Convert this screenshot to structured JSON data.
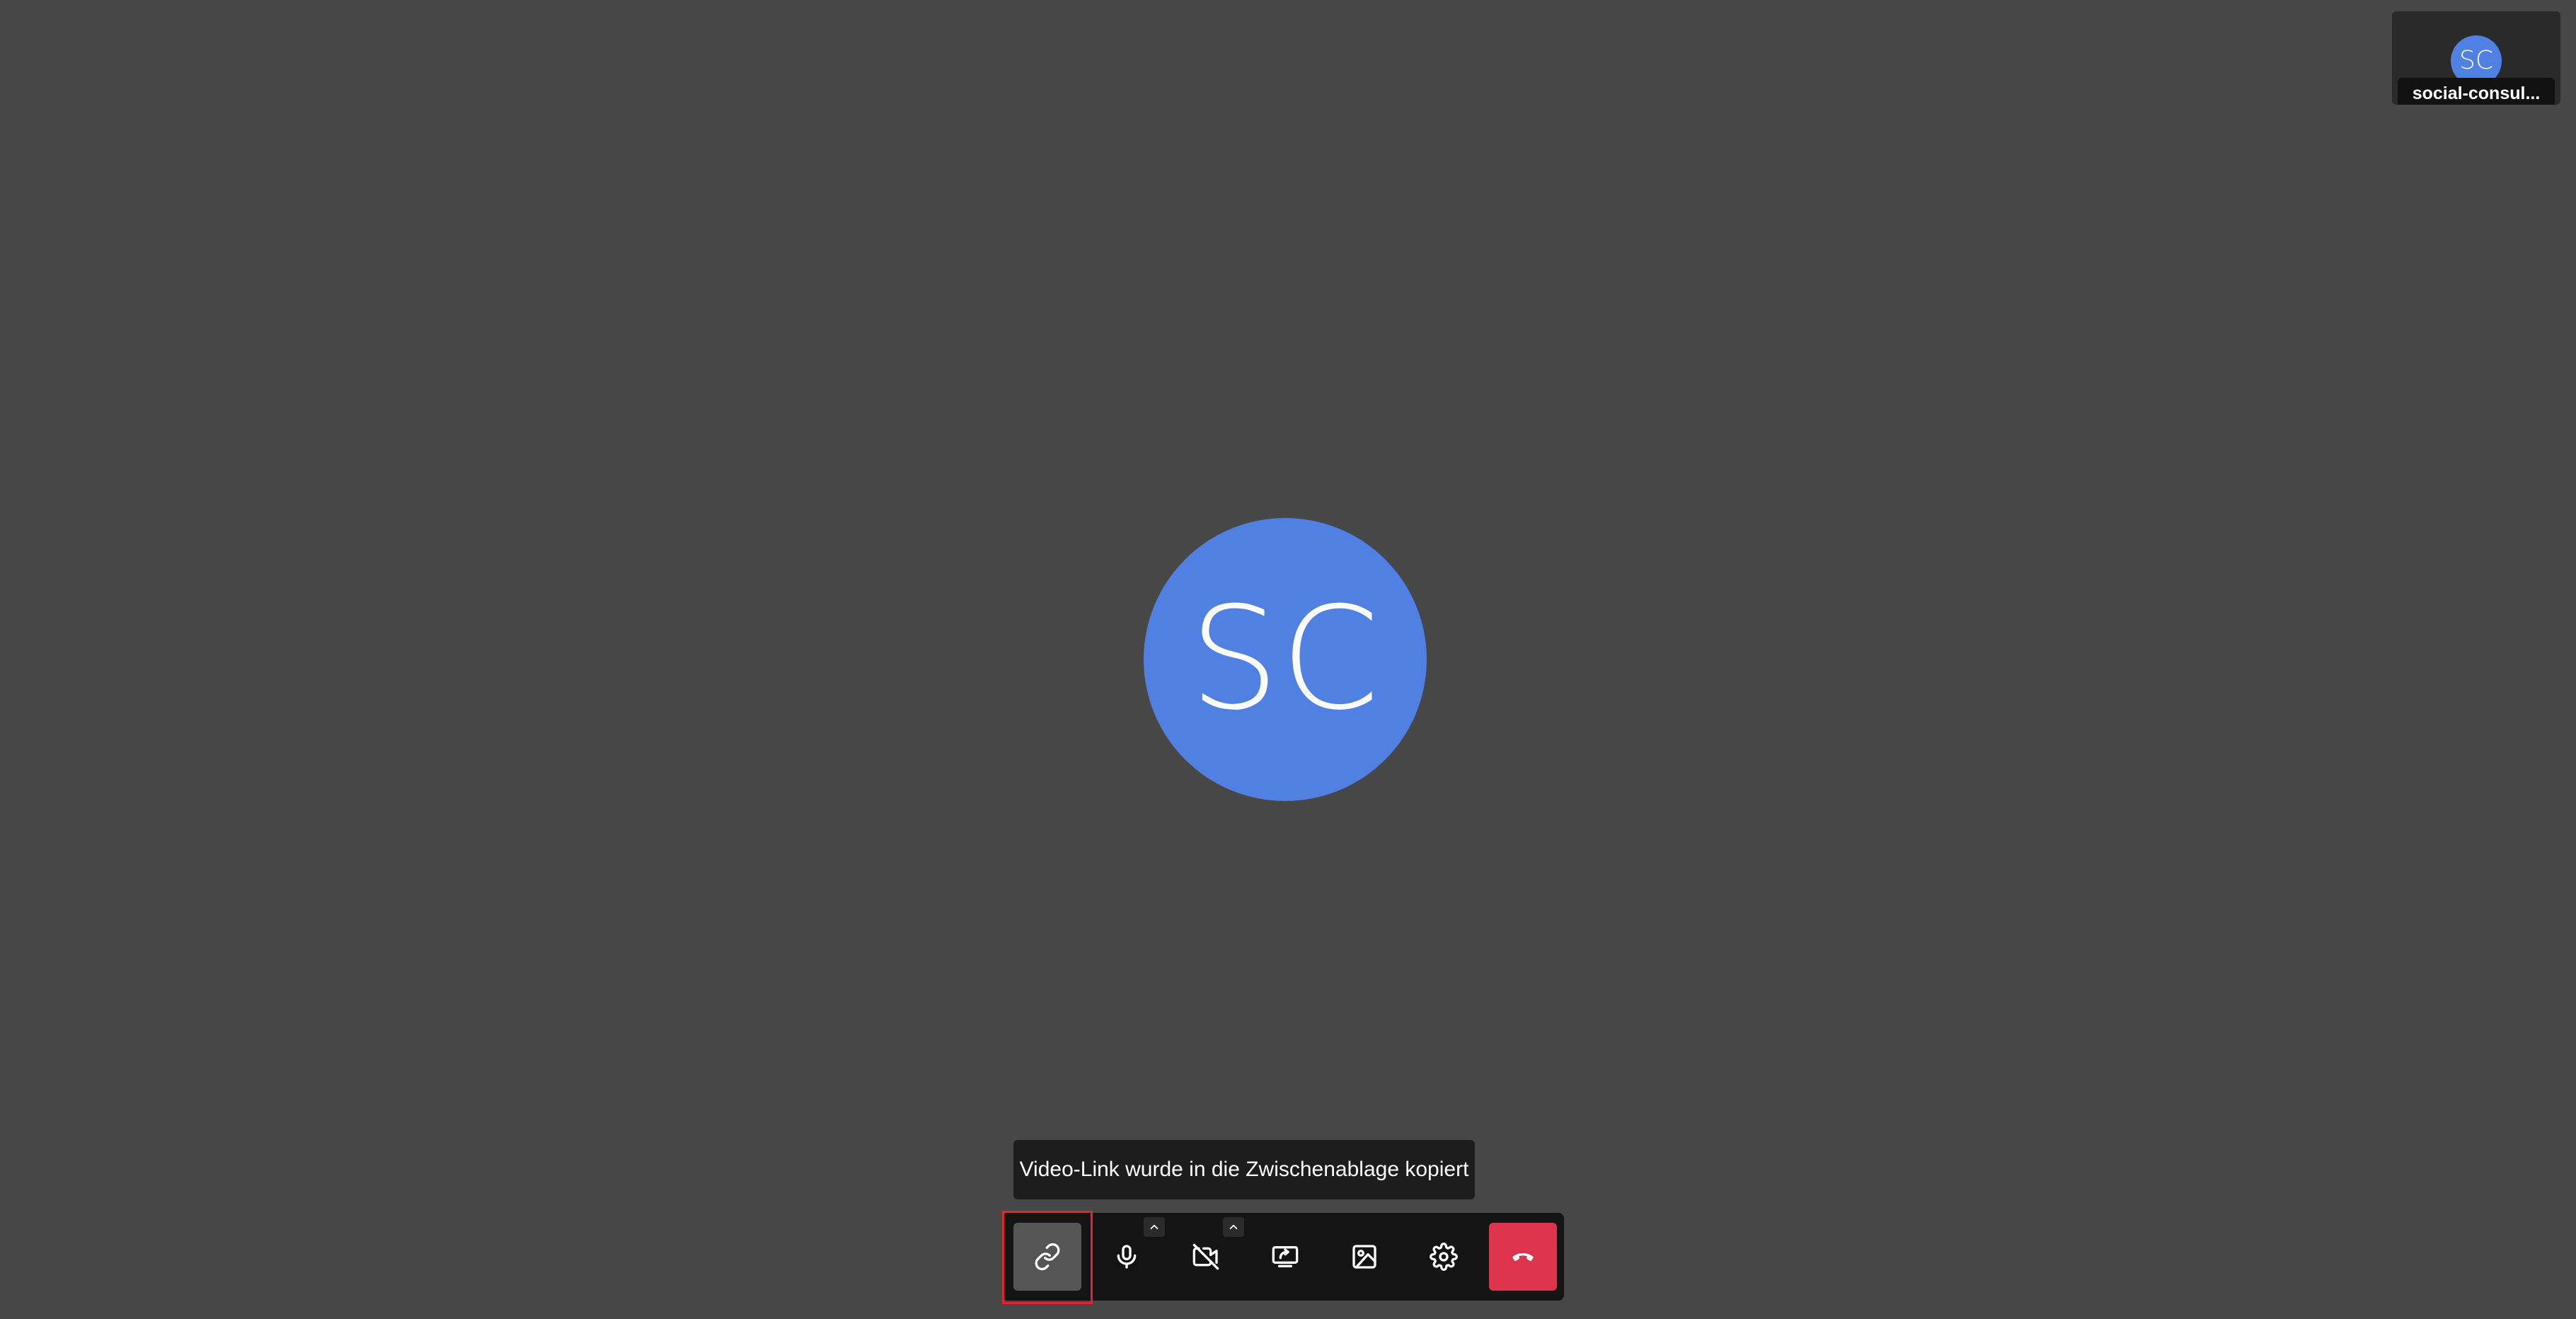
{
  "participant": {
    "initials": "SC",
    "avatar_color": "#5080e2"
  },
  "self_view": {
    "initials": "SC",
    "name": "social-consul..."
  },
  "tooltip": {
    "text": "Video-Link wurde in die Zwischenablage kopiert"
  },
  "toolbar": {
    "buttons": [
      {
        "name": "copy-link",
        "icon": "link-icon",
        "state": "active"
      },
      {
        "name": "microphone",
        "icon": "microphone-icon"
      },
      {
        "name": "camera",
        "icon": "camera-off-icon"
      },
      {
        "name": "screen-share",
        "icon": "screen-share-icon"
      },
      {
        "name": "background",
        "icon": "image-icon"
      },
      {
        "name": "settings",
        "icon": "gear-icon"
      },
      {
        "name": "hang-up",
        "icon": "phone-hangup-icon",
        "color": "#dd334d"
      }
    ]
  },
  "colors": {
    "background": "#474747",
    "toolbar": "#141414",
    "focus_ring": "#e0272e"
  }
}
